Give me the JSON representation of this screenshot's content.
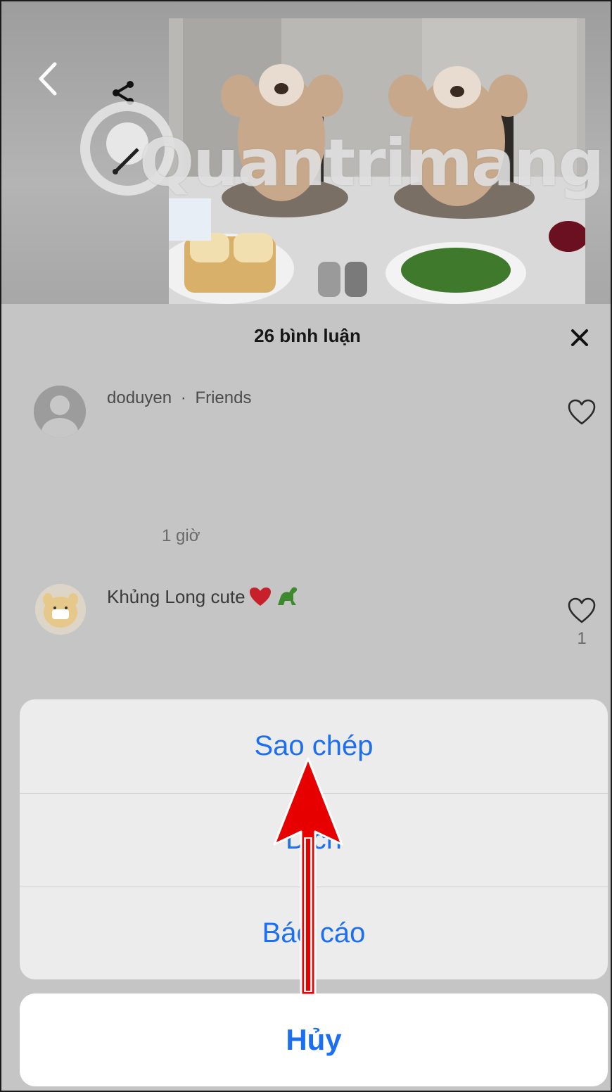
{
  "watermark": "Quantrimang",
  "header": {
    "back_icon": "chevron-left-icon",
    "share_icon": "share-icon"
  },
  "comments_panel": {
    "title": "26 bình luận",
    "close_icon": "close-icon",
    "comments": [
      {
        "username": "doduyen",
        "tag": "Friends",
        "separator": "·",
        "time": "1 giờ",
        "liked_icon": "heart-outline-icon"
      },
      {
        "text": "Khủng Long cute",
        "emoji": [
          "red-heart",
          "dinosaur"
        ],
        "likes": "1",
        "liked_icon": "heart-outline-icon"
      }
    ]
  },
  "action_sheet": {
    "items": [
      {
        "label": "Sao chép"
      },
      {
        "label": "Dịch"
      },
      {
        "label": "Báo cáo"
      }
    ],
    "cancel_label": "Hủy"
  },
  "colors": {
    "accent": "#1d6ff2",
    "annotation_arrow": "#e60000"
  }
}
